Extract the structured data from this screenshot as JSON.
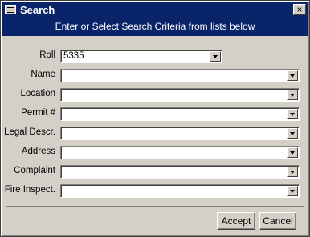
{
  "window": {
    "title": "Search",
    "close_glyph": "×",
    "icon": "form-icon"
  },
  "banner": "Enter or Select Search Criteria from lists below",
  "fields": [
    {
      "label": "Roll",
      "value": "5335"
    },
    {
      "label": "Name",
      "value": ""
    },
    {
      "label": "Location",
      "value": ""
    },
    {
      "label": "Permit #",
      "value": ""
    },
    {
      "label": "Legal Descr.",
      "value": ""
    },
    {
      "label": "Address",
      "value": ""
    },
    {
      "label": "Complaint",
      "value": ""
    },
    {
      "label": "Fire Inspect.",
      "value": ""
    }
  ],
  "buttons": {
    "accept": "Accept",
    "cancel": "Cancel"
  },
  "colors": {
    "titlebar": "#0a246a",
    "face": "#d4d0c8"
  }
}
